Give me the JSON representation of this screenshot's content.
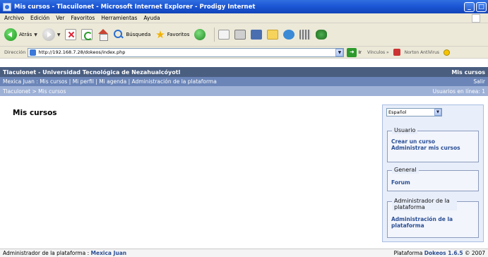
{
  "window": {
    "title": "Mis cursos - Tlacuilonet - Microsoft Internet Explorer - Prodigy Internet"
  },
  "menu": [
    "Archivo",
    "Edición",
    "Ver",
    "Favoritos",
    "Herramientas",
    "Ayuda"
  ],
  "toolbar": {
    "back_label": "Atrás",
    "search_label": "Búsqueda",
    "favorites_label": "Favoritos"
  },
  "address": {
    "label": "Dirección",
    "url": "http://192.168.7.28/dokeos/index.php",
    "go_label": "Ir",
    "links_label": "Vínculos",
    "links_chevron": "»",
    "norton_label": "Norton AntiVirus"
  },
  "site": {
    "name": "Tlaculonet - Universidad Tecnológica de Nezahualcóyotl",
    "header_right": "Mis cursos",
    "nav_text": "Mexica Juan : Mis cursos | Mi perfil | Mi agenda | Administración de la plataforma",
    "logout": "Salir",
    "breadcrumb": "Tlaculonet > Mis cursos",
    "online_users": "Usuarios en línea: 1"
  },
  "main": {
    "title": "Mis cursos"
  },
  "sidebar": {
    "language": "Español",
    "sections": [
      {
        "title": "Usuario",
        "links": [
          "Crear un curso",
          "Administrar mis cursos"
        ]
      },
      {
        "title": "General",
        "links": [
          "Forum"
        ]
      },
      {
        "title": "Administrador de la plataforma",
        "links": [
          "Administración de la plataforma"
        ]
      }
    ]
  },
  "footer": {
    "left_prefix": "Administrador de la plataforma :",
    "admin_name": "Mexica Juan",
    "right_prefix": "Plataforma",
    "platform": "Dokeos 1.6.5",
    "copyright": "© 2007"
  },
  "colors": {
    "header": "#4a5e80",
    "nav": "#6b85b8",
    "breadcrumb": "#9db0d6",
    "link": "#2b4f94"
  }
}
